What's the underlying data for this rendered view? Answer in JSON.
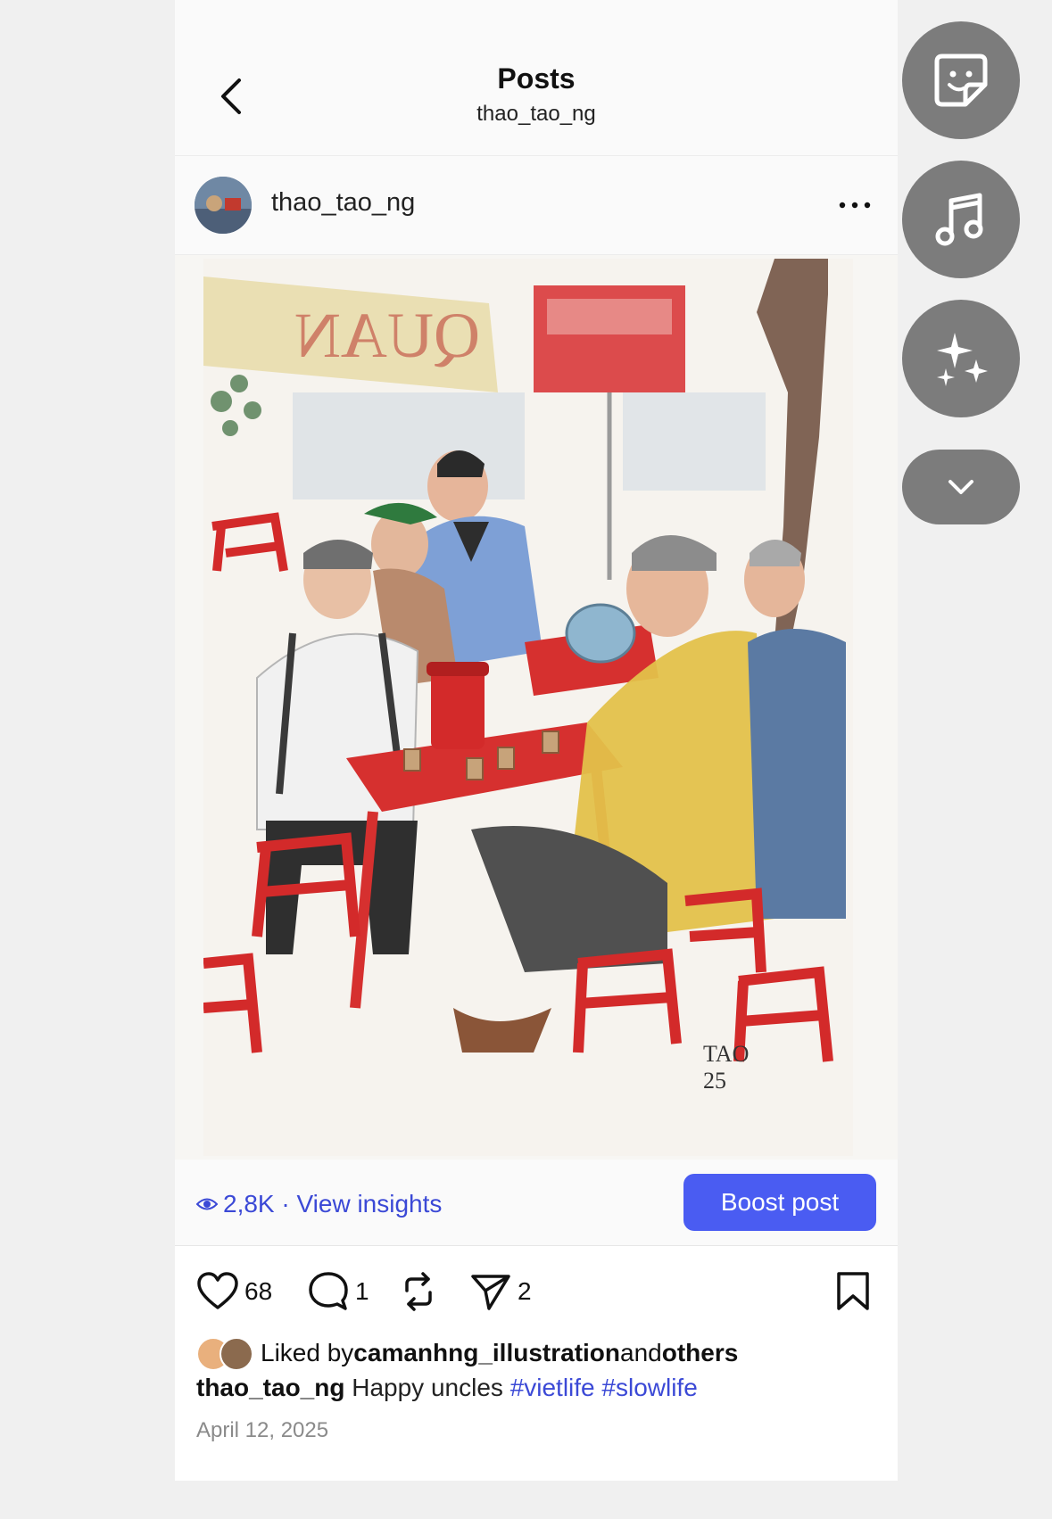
{
  "header": {
    "title": "Posts",
    "subtitle": "thao_tao_ng"
  },
  "post": {
    "author": "thao_tao_ng",
    "views": "2,8K · View insights",
    "boost_label": "Boost post",
    "likes": "68",
    "comments": "1",
    "shares": "2",
    "liked_prefix": "Liked by ",
    "liked_user": "camanhng_illustration",
    "liked_mid": " and ",
    "liked_others": "others",
    "caption_user": "thao_tao_ng",
    "caption_text": " Happy uncles ",
    "tag1": "#vietlife",
    "tag2": "#slowlife",
    "date": "April 12, 2025",
    "artwork_signature": "TAO 25"
  },
  "side_buttons": [
    "sticker-icon",
    "music-note-icon",
    "sparkles-icon",
    "chevron-down-icon"
  ],
  "colors": {
    "accent": "#4a5cf2",
    "link": "#3b49d6",
    "fab": "#7c7c7c"
  }
}
